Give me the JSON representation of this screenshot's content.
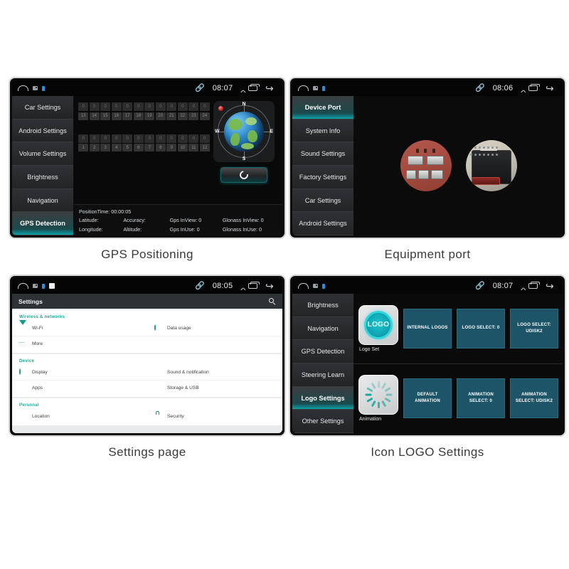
{
  "panels": [
    {
      "id": "gps",
      "caption": "GPS Positioning",
      "statusbar": {
        "time": "08:07",
        "bluetooth": "bluetooth-icon",
        "home": "home-icon",
        "recent": "recent-apps-icon",
        "back": "back-icon",
        "expand": "expand-icon"
      },
      "nav": [
        {
          "label": "Car Settings",
          "active": false
        },
        {
          "label": "Android Settings",
          "active": false
        },
        {
          "label": "Volume Settings",
          "active": false
        },
        {
          "label": "Brightness",
          "active": false
        },
        {
          "label": "Navigation",
          "active": false
        },
        {
          "label": "GPS Detection",
          "active": true
        }
      ],
      "signal": {
        "group_top": {
          "values": [
            "0",
            "0",
            "0",
            "0",
            "0",
            "0",
            "0",
            "0",
            "0",
            "0",
            "0",
            "0"
          ],
          "ids": [
            "13",
            "14",
            "15",
            "16",
            "17",
            "18",
            "19",
            "20",
            "21",
            "22",
            "23",
            "24"
          ]
        },
        "group_bottom": {
          "values": [
            "0",
            "0",
            "0",
            "0",
            "0",
            "0",
            "0",
            "0",
            "0",
            "0",
            "0",
            "0"
          ],
          "ids": [
            "1",
            "2",
            "3",
            "4",
            "5",
            "6",
            "7",
            "8",
            "9",
            "10",
            "11",
            "12"
          ]
        }
      },
      "compass": {
        "north": "N",
        "south": "S",
        "west": "W",
        "east": "E"
      },
      "refresh_button": "refresh-icon",
      "info": {
        "position_time": "PositionTime: 00:00:05",
        "fields": [
          "Latitude:",
          "Accuracy:",
          "Gps InView: 0",
          "Glonass InView: 0",
          "Longitude:",
          "Altitude:",
          "Gps InUse: 0",
          "Glonass InUse: 0"
        ]
      }
    },
    {
      "id": "port",
      "caption": "Equipment port",
      "statusbar": {
        "time": "08:06"
      },
      "nav": [
        {
          "label": "Device Port",
          "active": true
        },
        {
          "label": "System Info",
          "active": false
        },
        {
          "label": "Sound Settings",
          "active": false
        },
        {
          "label": "Factory Settings",
          "active": false
        },
        {
          "label": "Car Settings",
          "active": false
        },
        {
          "label": "Android Settings",
          "active": false
        }
      ],
      "photos": [
        "wiring-harness-photo",
        "connector-block-photo"
      ]
    },
    {
      "id": "settings",
      "caption": "Settings page",
      "statusbar": {
        "time": "08:05"
      },
      "header": {
        "title": "Settings",
        "search": "search-icon"
      },
      "sections": [
        {
          "category": "Wireless & networks",
          "rows": [
            [
              {
                "label": "Wi-Fi",
                "icon": "wifi-icon"
              },
              {
                "label": "Data usage",
                "icon": "data-usage-icon"
              }
            ],
            [
              {
                "label": "More",
                "icon": "more-icon"
              },
              {
                "label": "",
                "icon": ""
              }
            ]
          ]
        },
        {
          "category": "Device",
          "rows": [
            [
              {
                "label": "Display",
                "icon": "display-icon"
              },
              {
                "label": "Sound & notification",
                "icon": "sound-icon"
              }
            ],
            [
              {
                "label": "Apps",
                "icon": "apps-icon"
              },
              {
                "label": "Storage & USB",
                "icon": "storage-icon"
              }
            ]
          ]
        },
        {
          "category": "Personal",
          "rows": [
            [
              {
                "label": "Location",
                "icon": "location-icon"
              },
              {
                "label": "Security",
                "icon": "lock-icon"
              }
            ]
          ]
        }
      ]
    },
    {
      "id": "logo",
      "caption": "Icon LOGO Settings",
      "statusbar": {
        "time": "08:07"
      },
      "nav": [
        {
          "label": "Brightness",
          "active": false
        },
        {
          "label": "Navigation",
          "active": false
        },
        {
          "label": "GPS Detection",
          "active": false
        },
        {
          "label": "Steering Learn",
          "active": false
        },
        {
          "label": "Logo Settings",
          "active": true
        },
        {
          "label": "Other Settings",
          "active": false
        }
      ],
      "sections": [
        {
          "thumb_text": "LOGO",
          "thumb_icon": "logo-badge-icon",
          "thumb_label": "Logo Set",
          "tiles": [
            "INTERNAL LOGOS",
            "LOGO SELECT:\n0",
            "LOGO SELECT:\nUDISK2"
          ]
        },
        {
          "thumb_text": "",
          "thumb_icon": "loading-spinner-icon",
          "thumb_label": "Animation",
          "tiles": [
            "DEFAULT ANIMATION",
            "ANIMATION SELECT:\n0",
            "ANIMATION SELECT:\nUDISK2"
          ]
        }
      ]
    }
  ],
  "colors": {
    "accent_teal": "#0ea3a8",
    "tile_blue": "#1d5467",
    "settings_green": "#0f9b8e",
    "device_bg": "#0b0b0c",
    "page_bg": "#ffffff"
  }
}
